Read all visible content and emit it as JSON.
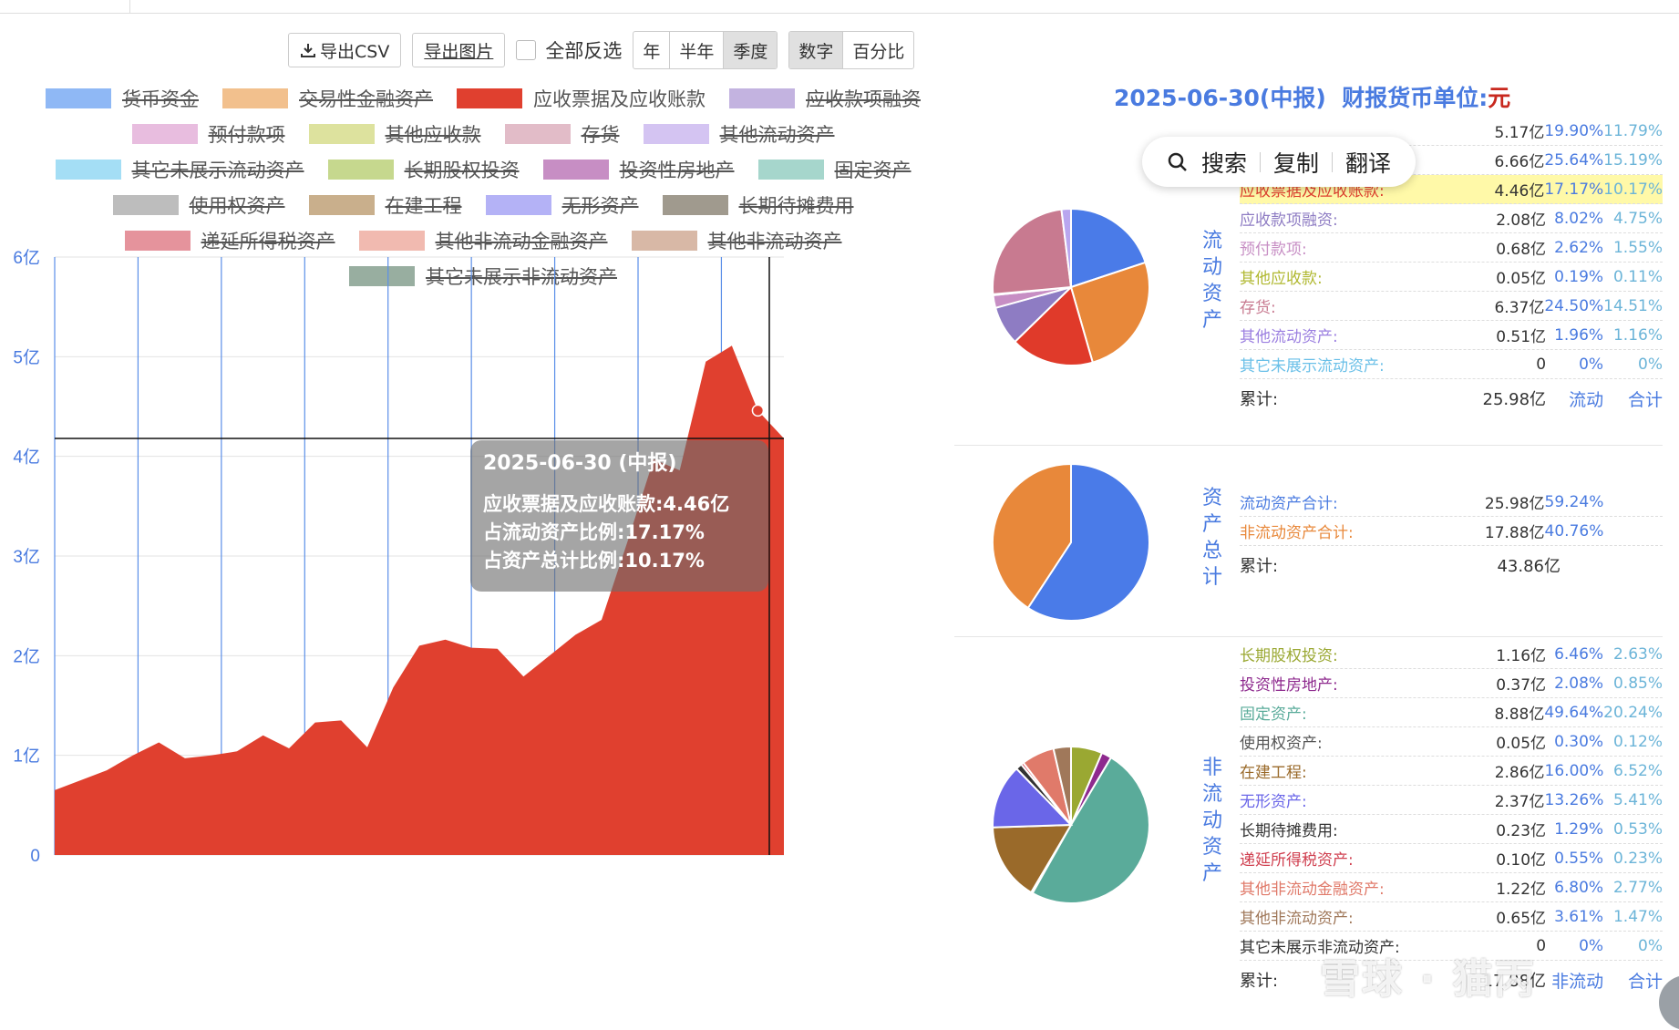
{
  "toolbar": {
    "export_csv": "导出CSV",
    "export_image": "导出图片",
    "invert_all": "全部反选",
    "period_options": [
      "年",
      "半年",
      "季度"
    ],
    "period_selected": "季度",
    "mode_options": [
      "数字",
      "百分比"
    ],
    "mode_selected": "数字"
  },
  "legend": [
    {
      "label": "货币资金",
      "color": "#8fb8f5",
      "off": true
    },
    {
      "label": "交易性金融资产",
      "color": "#f2c08d",
      "off": true
    },
    {
      "label": "应收票据及应收账款",
      "color": "#e0402f",
      "off": false
    },
    {
      "label": "应收款项融资",
      "color": "#c3b3e0",
      "off": true
    },
    {
      "label": "预付款项",
      "color": "#e8bddf",
      "off": true
    },
    {
      "label": "其他应收款",
      "color": "#dde29e",
      "off": true
    },
    {
      "label": "存货",
      "color": "#e2bcc8",
      "off": true
    },
    {
      "label": "其他流动资产",
      "color": "#d4c4f2",
      "off": true
    },
    {
      "label": "其它未展示流动资产",
      "color": "#a4def5",
      "off": true
    },
    {
      "label": "长期股权投资",
      "color": "#c6d88e",
      "off": true
    },
    {
      "label": "投资性房地产",
      "color": "#c78ec4",
      "off": true
    },
    {
      "label": "固定资产",
      "color": "#a6d6cc",
      "off": true
    },
    {
      "label": "使用权资产",
      "color": "#bdbdbd",
      "off": true
    },
    {
      "label": "在建工程",
      "color": "#c9af8c",
      "off": true
    },
    {
      "label": "无形资产",
      "color": "#b4b2f6",
      "off": true
    },
    {
      "label": "长期待摊费用",
      "color": "#a09a8e",
      "off": true
    },
    {
      "label": "递延所得税资产",
      "color": "#e5939c",
      "off": true
    },
    {
      "label": "其他非流动金融资产",
      "color": "#f1bab0",
      "off": true
    },
    {
      "label": "其他非流动资产",
      "color": "#d8b8a6",
      "off": true
    },
    {
      "label": "其它未展示非流动资产",
      "color": "#98aea0",
      "off": true
    }
  ],
  "chart_data": {
    "type": "area",
    "series": [
      {
        "name": "应收票据及应收账款",
        "color": "#e0402f"
      }
    ],
    "values": [
      0.65,
      0.75,
      0.85,
      1.0,
      1.13,
      0.97,
      1.0,
      1.04,
      1.2,
      1.07,
      1.33,
      1.35,
      1.08,
      1.68,
      2.1,
      2.16,
      2.08,
      2.07,
      1.79,
      2.0,
      2.21,
      2.36,
      3.15,
      3.97,
      3.86,
      4.95,
      5.11,
      4.46,
      4.18
    ],
    "y_ticks": [
      "0",
      "1亿",
      "2亿",
      "3亿",
      "4亿",
      "5亿",
      "6亿"
    ],
    "ylim": [
      0,
      6
    ],
    "crosshair_value": 4.18,
    "tooltip": {
      "title": "2025-06-30 (中报)",
      "lines": [
        "应收票据及应收账款:4.46亿",
        "占流动资产比例:17.17%",
        "占资产总计比例:10.17%"
      ]
    }
  },
  "right_panel": {
    "title_date": "2025-06-30(中报)",
    "title_unit_label": "财报货币单位:",
    "title_unit": "元",
    "popup": {
      "search": "搜索",
      "copy": "复制",
      "translate": "翻译"
    },
    "current": {
      "header": "流动资产",
      "rows": [
        {
          "name": "",
          "value": "5.17亿",
          "p1": "19.90%",
          "p2": "11.79%",
          "color": "#333"
        },
        {
          "name": "",
          "value": "6.66亿",
          "p1": "25.64%",
          "p2": "15.19%",
          "color": "#333"
        },
        {
          "name": "应收票据及应收账款:",
          "value": "4.46亿",
          "p1": "17.17%",
          "p2": "10.17%",
          "color": "#e0402f",
          "hl": true
        },
        {
          "name": "应收款项融资:",
          "value": "2.08亿",
          "p1": "8.02%",
          "p2": "4.75%",
          "color": "#8e7cc3"
        },
        {
          "name": "预付款项:",
          "value": "0.68亿",
          "p1": "2.62%",
          "p2": "1.55%",
          "color": "#c78ec4"
        },
        {
          "name": "其他应收款:",
          "value": "0.05亿",
          "p1": "0.19%",
          "p2": "0.11%",
          "color": "#b0b830"
        },
        {
          "name": "存货:",
          "value": "6.37亿",
          "p1": "24.50%",
          "p2": "14.51%",
          "color": "#c87a90"
        },
        {
          "name": "其他流动资产:",
          "value": "0.51亿",
          "p1": "1.96%",
          "p2": "1.16%",
          "color": "#9b7fe0"
        },
        {
          "name": "其它未展示流动资产:",
          "value": "0",
          "p1": "0%",
          "p2": "0%",
          "color": "#6bc0e8"
        }
      ],
      "sum_label": "累计:",
      "sum_value": "25.98亿",
      "sum_link1": "流动",
      "sum_link2": "合计",
      "pie": [
        {
          "value": 19.9,
          "color": "#4a7be8"
        },
        {
          "value": 25.64,
          "color": "#e8883a"
        },
        {
          "value": 17.17,
          "color": "#e03a2a"
        },
        {
          "value": 8.02,
          "color": "#8e7cc3"
        },
        {
          "value": 2.62,
          "color": "#c78ec4"
        },
        {
          "value": 0.19,
          "color": "#b0b830"
        },
        {
          "value": 24.5,
          "color": "#c87a90"
        },
        {
          "value": 1.96,
          "color": "#b9a6ef"
        }
      ]
    },
    "total": {
      "header": "资产总计",
      "rows": [
        {
          "name": "流动资产合计:",
          "value": "25.98亿",
          "p1": "59.24%",
          "p2": "",
          "color": "#4a7be0"
        },
        {
          "name": "非流动资产合计:",
          "value": "17.88亿",
          "p1": "40.76%",
          "p2": "",
          "color": "#e8883a"
        }
      ],
      "sum_label": "累计:",
      "sum_value": "43.86亿",
      "pie": [
        {
          "value": 59.24,
          "color": "#4a7be8"
        },
        {
          "value": 40.76,
          "color": "#e8883a"
        }
      ]
    },
    "noncurrent": {
      "header": "非流动资产",
      "rows": [
        {
          "name": "长期股权投资:",
          "value": "1.16亿",
          "p1": "6.46%",
          "p2": "2.63%",
          "color": "#9aa832"
        },
        {
          "name": "投资性房地产:",
          "value": "0.37亿",
          "p1": "2.08%",
          "p2": "0.85%",
          "color": "#8e2a8e"
        },
        {
          "name": "固定资产:",
          "value": "8.88亿",
          "p1": "49.64%",
          "p2": "20.24%",
          "color": "#5aab9a"
        },
        {
          "name": "使用权资产:",
          "value": "0.05亿",
          "p1": "0.30%",
          "p2": "0.12%",
          "color": "#555"
        },
        {
          "name": "在建工程:",
          "value": "2.86亿",
          "p1": "16.00%",
          "p2": "6.52%",
          "color": "#9a6a2a"
        },
        {
          "name": "无形资产:",
          "value": "2.37亿",
          "p1": "13.26%",
          "p2": "5.41%",
          "color": "#6a66e8"
        },
        {
          "name": "长期待摊费用:",
          "value": "0.23亿",
          "p1": "1.29%",
          "p2": "0.53%",
          "color": "#333"
        },
        {
          "name": "递延所得税资产:",
          "value": "0.10亿",
          "p1": "0.55%",
          "p2": "0.23%",
          "color": "#d04050"
        },
        {
          "name": "其他非流动金融资产:",
          "value": "1.22亿",
          "p1": "6.80%",
          "p2": "2.77%",
          "color": "#e07a6a"
        },
        {
          "name": "其他非流动资产:",
          "value": "0.65亿",
          "p1": "3.61%",
          "p2": "1.47%",
          "color": "#a0785a"
        },
        {
          "name": "其它未展示非流动资产:",
          "value": "0",
          "p1": "0%",
          "p2": "0%",
          "color": "#333"
        }
      ],
      "sum_label": "累计:",
      "sum_value": "17.88亿",
      "sum_link1": "非流动",
      "sum_link2": "合计",
      "pie": [
        {
          "value": 6.46,
          "color": "#9aa832"
        },
        {
          "value": 2.08,
          "color": "#8e2a8e"
        },
        {
          "value": 49.64,
          "color": "#5aab9a"
        },
        {
          "value": 0.3,
          "color": "#555555"
        },
        {
          "value": 16.0,
          "color": "#9a6a2a"
        },
        {
          "value": 13.26,
          "color": "#6a66e8"
        },
        {
          "value": 1.29,
          "color": "#333333"
        },
        {
          "value": 0.55,
          "color": "#d04050"
        },
        {
          "value": 6.8,
          "color": "#e07a6a"
        },
        {
          "value": 3.61,
          "color": "#a0785a"
        }
      ]
    },
    "watermark": "雪球 · 猫丙"
  }
}
